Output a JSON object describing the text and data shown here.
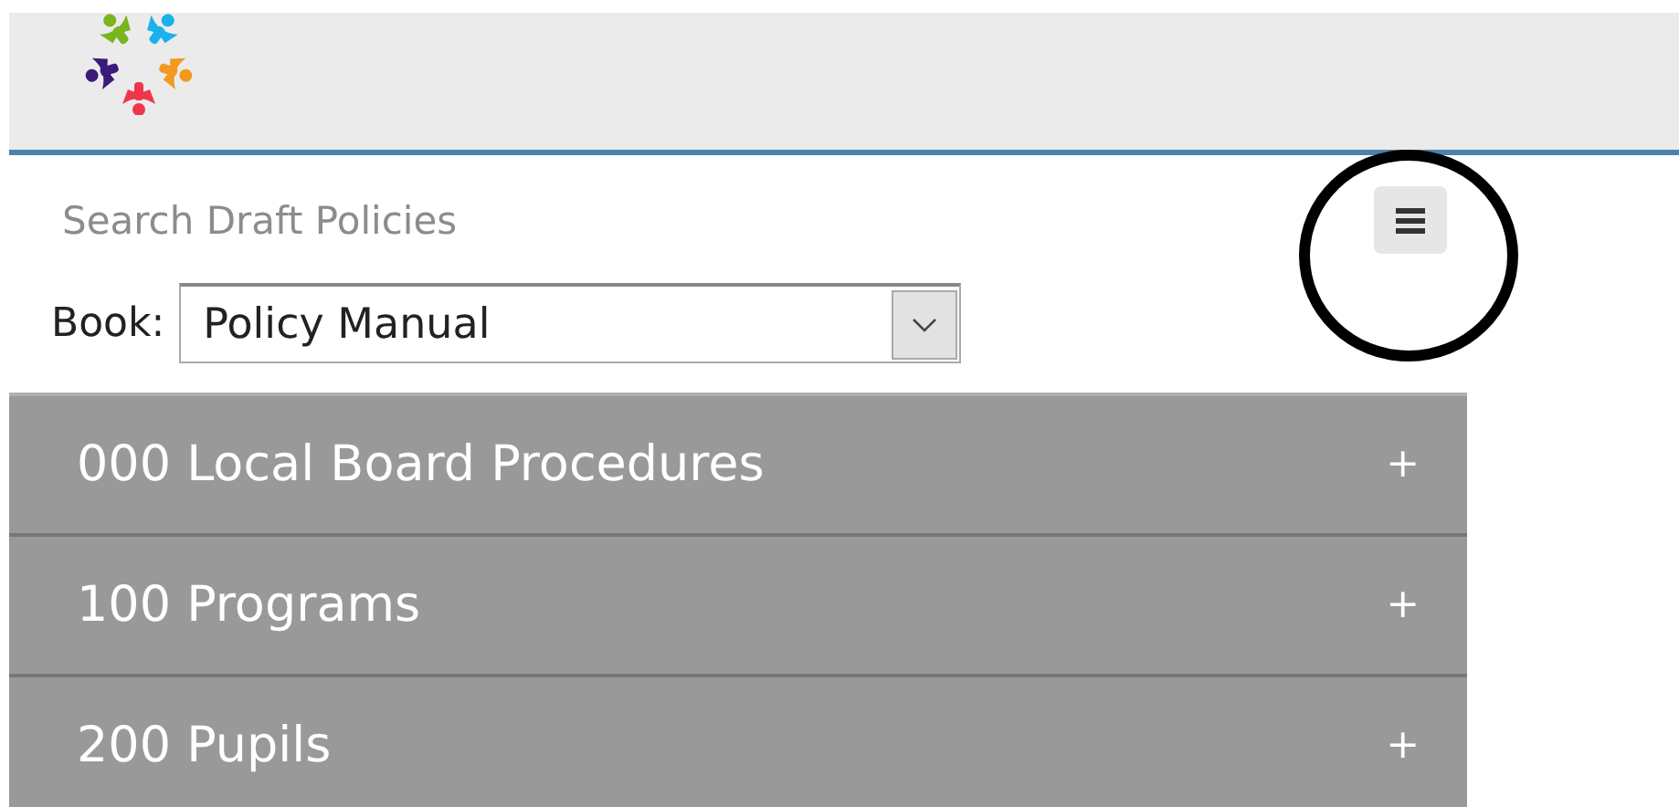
{
  "search": {
    "placeholder": "Search Draft Policies"
  },
  "book": {
    "label": "Book:",
    "value": "Policy Manual"
  },
  "sections": [
    {
      "title": "000 Local Board Procedures",
      "toggle": "+"
    },
    {
      "title": "100 Programs",
      "toggle": "+"
    },
    {
      "title": "200 Pupils",
      "toggle": "+"
    }
  ]
}
